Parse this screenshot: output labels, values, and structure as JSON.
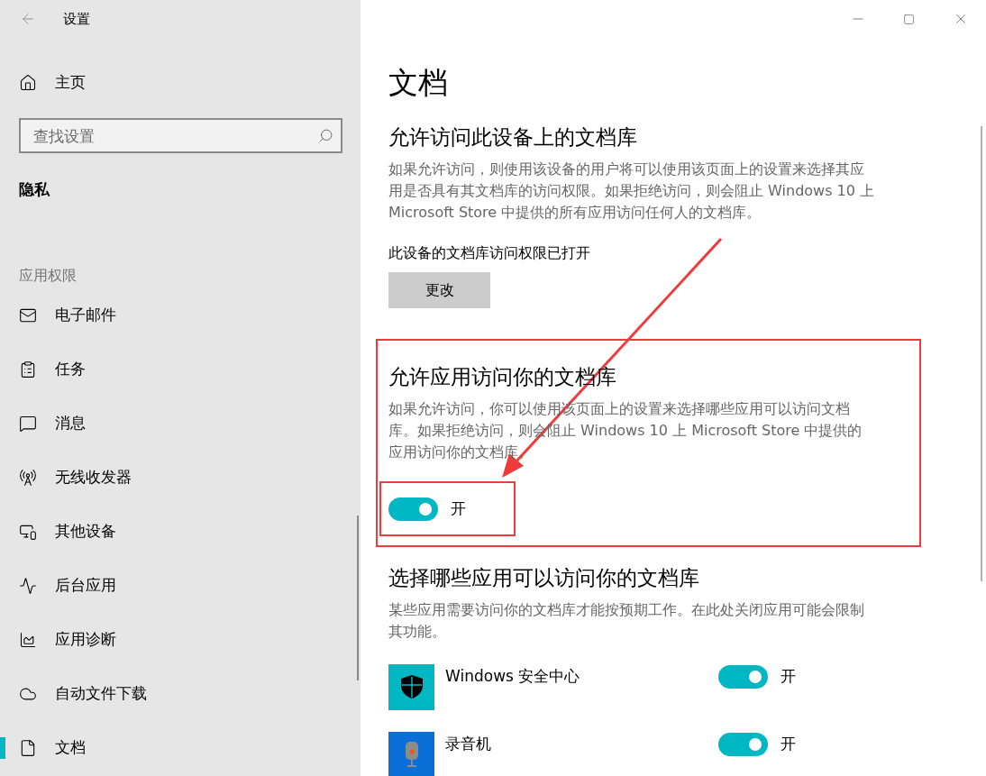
{
  "window": {
    "title": "设置"
  },
  "sidebar": {
    "home": "主页",
    "search": {
      "placeholder": "查找设置"
    },
    "section": "隐私",
    "group": "应用权限",
    "items": [
      {
        "label": "电子邮件",
        "selected": false
      },
      {
        "label": "任务",
        "selected": false
      },
      {
        "label": "消息",
        "selected": false
      },
      {
        "label": "无线收发器",
        "selected": false
      },
      {
        "label": "其他设备",
        "selected": false
      },
      {
        "label": "后台应用",
        "selected": false
      },
      {
        "label": "应用诊断",
        "selected": false
      },
      {
        "label": "自动文件下载",
        "selected": false
      },
      {
        "label": "文档",
        "selected": true
      }
    ]
  },
  "page": {
    "title": "文档",
    "device_access": {
      "heading": "允许访问此设备上的文档库",
      "text": "如果允许访问，则使用该设备的用户将可以使用该页面上的设置来选择其应用是否具有其文档库的访问权限。如果拒绝访问，则会阻止 Windows 10 上 Microsoft Store 中提供的所有应用访问任何人的文档库。",
      "status": "此设备的文档库访问权限已打开",
      "button": "更改"
    },
    "app_access": {
      "heading": "允许应用访问你的文档库",
      "text": "如果允许访问，你可以使用该页面上的设置来选择哪些应用可以访问文档库。如果拒绝访问，则会阻止 Windows 10 上 Microsoft Store 中提供的应用访问你的文档库。",
      "highlighted": true,
      "toggle": {
        "on": true,
        "label": "开",
        "highlighted": true
      }
    },
    "app_list": {
      "heading": "选择哪些应用可以访问你的文档库",
      "text": "某些应用需要访问你的文档库才能按预期工作。在此处关闭应用可能会限制其功能。",
      "apps": [
        {
          "name": "Windows 安全中心",
          "on": true,
          "label": "开"
        },
        {
          "name": "录音机",
          "on": true,
          "label": "开"
        }
      ]
    }
  }
}
